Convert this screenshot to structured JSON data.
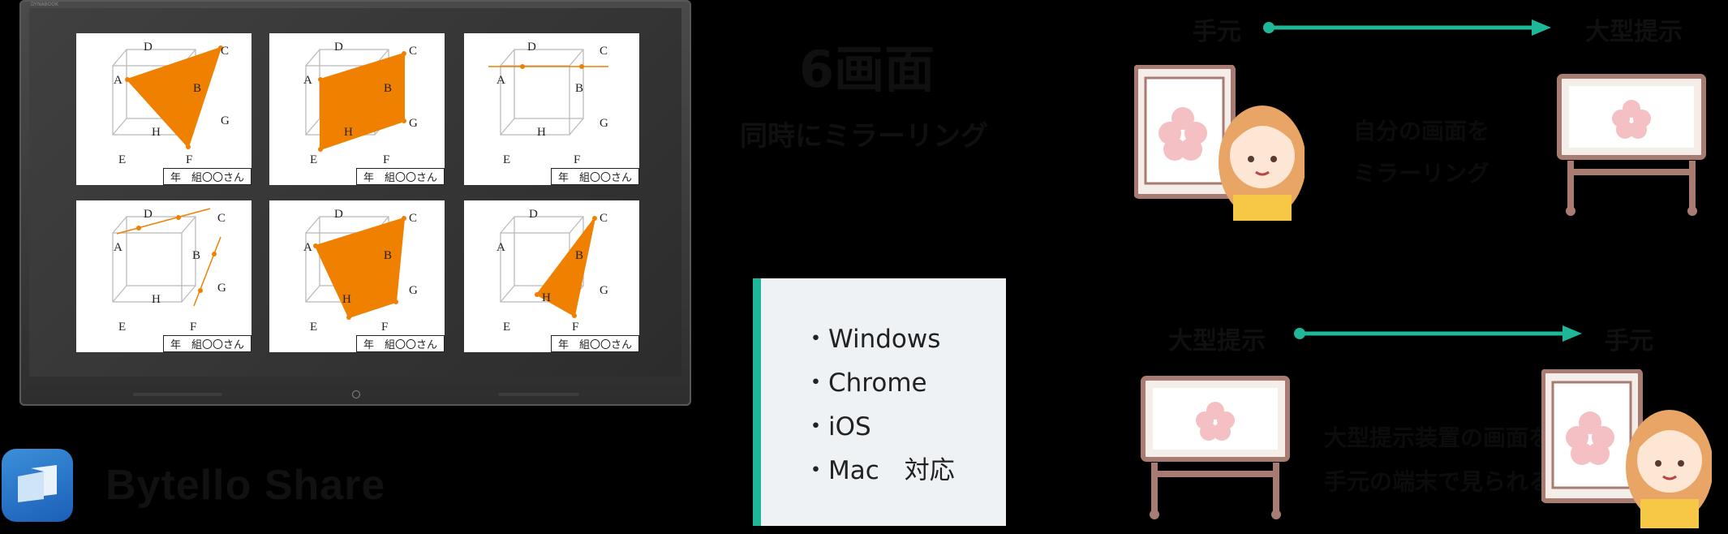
{
  "monitor": {
    "brand": "DYNABOOK",
    "cards": [
      {
        "tag": "年　組〇〇さん"
      },
      {
        "tag": "年　組〇〇さん"
      },
      {
        "tag": "年　組〇〇さん"
      },
      {
        "tag": "年　組〇〇さん"
      },
      {
        "tag": "年　組〇〇さん"
      },
      {
        "tag": "年　組〇〇さん"
      }
    ],
    "vertex_labels": {
      "A": "A",
      "B": "B",
      "C": "C",
      "D": "D",
      "E": "E",
      "F": "F",
      "G": "G",
      "H": "H"
    }
  },
  "logo": {
    "text": "Bytello Share"
  },
  "middle": {
    "title": "6画面",
    "subtitle": "同時にミラーリング"
  },
  "os_panel": {
    "items": [
      "・Windows",
      "・Chrome",
      "・iOS",
      "・Mac　対応"
    ]
  },
  "flow_top": {
    "from": "手元",
    "to": "大型提示",
    "desc_line1": "自分の画面を",
    "desc_line2": "ミラーリング"
  },
  "flow_bottom": {
    "from": "大型提示",
    "to": "手元",
    "desc_line1": "大型提示装置の画面を",
    "desc_line2": "手元の端末で見られる"
  },
  "colors": {
    "accent": "#1fb79a",
    "orange": "#f08000",
    "easel": "#a87c72",
    "blossom": "#f4c0c4"
  }
}
